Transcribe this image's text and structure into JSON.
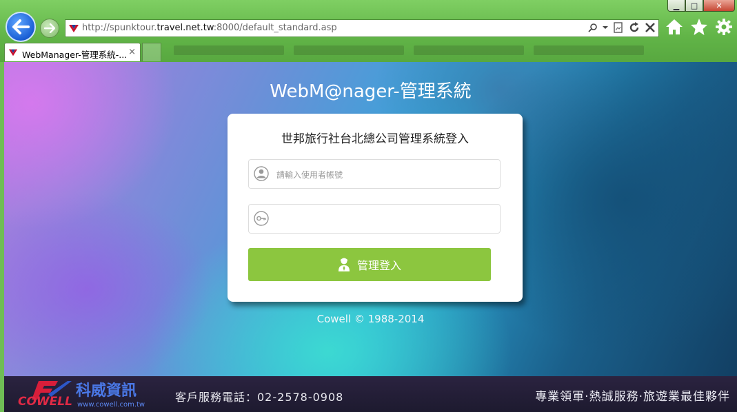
{
  "browser": {
    "url_prefix": "http://spunktour.",
    "url_domain": "travel.net.tw",
    "url_suffix": ":8000/default_standard.asp",
    "tab_title": "WebManager-管理系統-...",
    "tab_close": "×",
    "window_controls": {
      "minimize": "▁",
      "maximize": "□",
      "close": "✕"
    }
  },
  "page": {
    "heading": "WebM@nager-管理系統",
    "login_title": "世邦旅行社台北總公司管理系統登入",
    "username_placeholder": "請輸入使用者帳號",
    "password_value": "",
    "login_button": "管理登入",
    "copyright": "Cowell © 1988-2014"
  },
  "footer": {
    "logo_brand": "COWELL",
    "logo_cn": "科威資訊",
    "logo_url": "www.cowell.com.tw",
    "phone": "客戶服務電話：02-2578-0908",
    "slogan": "專業領軍·熱誠服務·旅遊業最佳夥伴"
  },
  "colors": {
    "login_button": "#8cc63f",
    "browser_frame": "#61b447",
    "footer_bg": "#221e35"
  },
  "icons": [
    "back-arrow-icon",
    "forward-arrow-icon",
    "search-icon",
    "refresh-icon",
    "stop-icon",
    "home-icon",
    "favorites-star-icon",
    "settings-gear-icon",
    "user-icon",
    "key-icon",
    "admin-user-icon"
  ]
}
